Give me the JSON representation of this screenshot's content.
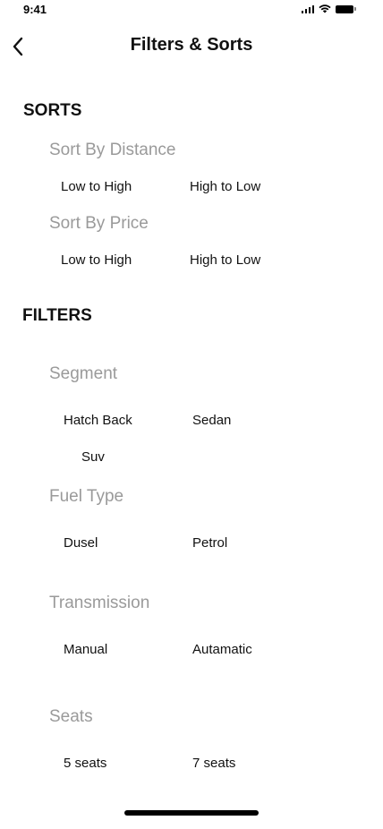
{
  "status_bar": {
    "time": "9:41"
  },
  "header": {
    "title": "Filters & Sorts"
  },
  "sorts": {
    "title": "SORTS",
    "by_distance": {
      "label": "Sort By Distance",
      "options": [
        "Low to High",
        "High to Low"
      ]
    },
    "by_price": {
      "label": "Sort By Price",
      "options": [
        "Low to High",
        "High to Low"
      ]
    }
  },
  "filters": {
    "title": "FILTERS",
    "segment": {
      "label": "Segment",
      "options": [
        "Hatch Back",
        "Sedan",
        "Suv"
      ]
    },
    "fuel_type": {
      "label": "Fuel Type",
      "options": [
        "Dusel",
        "Petrol"
      ]
    },
    "transmission": {
      "label": "Transmission",
      "options": [
        "Manual",
        "Autamatic"
      ]
    },
    "seats": {
      "label": "Seats",
      "options": [
        "5 seats",
        "7 seats"
      ]
    }
  }
}
